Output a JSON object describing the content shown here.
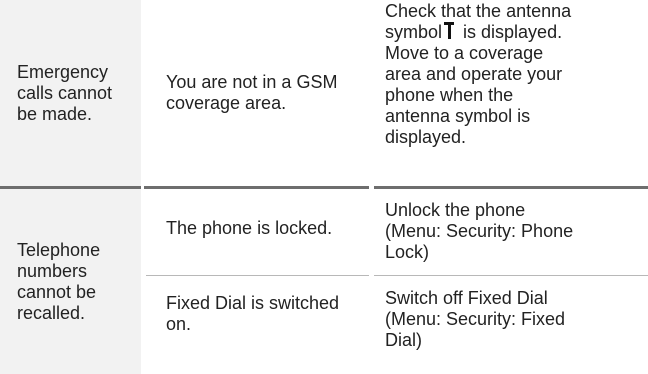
{
  "rows": [
    {
      "problem": "Emergency calls cannot be made.",
      "entries": [
        {
          "cause": "You are not in a GSM coverage area.",
          "remedy_lines": [
            "Check that the antenna",
            "symbol",
            "is displayed.",
            "Move to a coverage",
            "area and operate your",
            "phone when the",
            "antenna symbol is",
            "displayed."
          ],
          "remedy_icon": "antenna-icon"
        }
      ]
    },
    {
      "problem": "Telephone numbers cannot be recalled.",
      "entries": [
        {
          "cause": "The phone is locked.",
          "remedy_lines": [
            "Unlock the phone",
            "(Menu: Security: Phone",
            "Lock)"
          ]
        },
        {
          "cause": "Fixed Dial is switched on.",
          "remedy_lines": [
            "Switch off Fixed Dial",
            "(Menu: Security: Fixed",
            "Dial)"
          ]
        }
      ]
    }
  ],
  "colors": {
    "problem_column_bg": "#f2f2f2",
    "row_separator": "#6e6e6e",
    "sub_separator": "#b8b8b8",
    "text": "#222222"
  }
}
